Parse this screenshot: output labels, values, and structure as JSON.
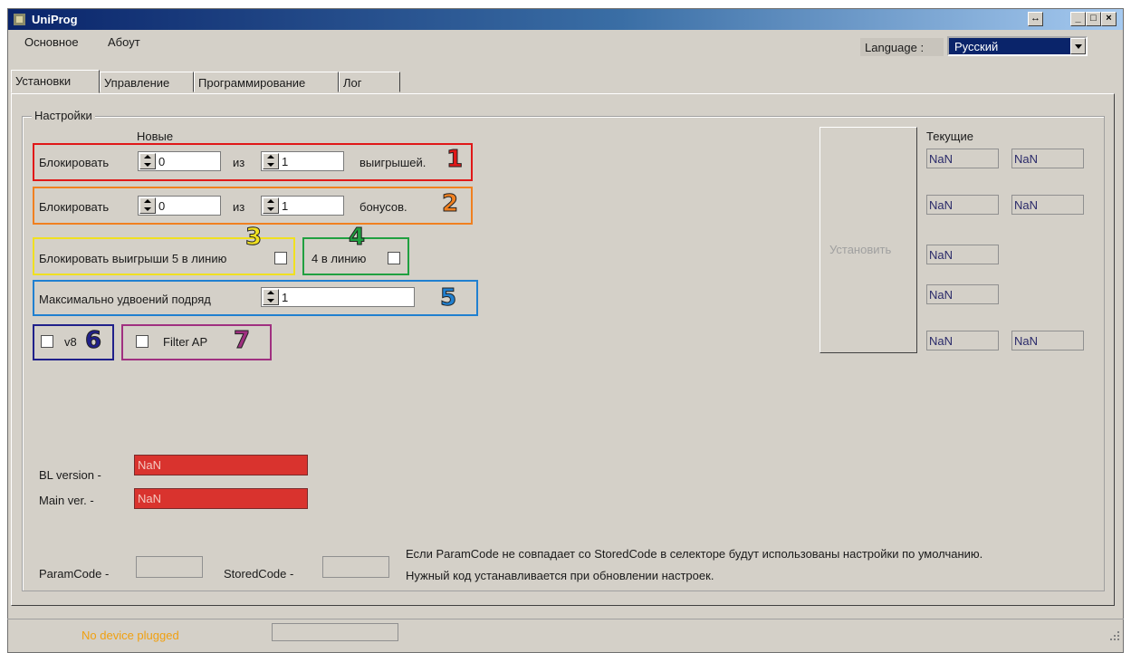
{
  "window": {
    "title": "UniProg"
  },
  "menu": {
    "items": [
      "Основное",
      "Абоут"
    ]
  },
  "language": {
    "label": "Language :",
    "value": "Русский"
  },
  "tabs": [
    "Установки",
    "Управление",
    "Программирование",
    "Лог"
  ],
  "settings": {
    "group_title": "Настройки",
    "new_header": "Новые",
    "current_header": "Текущие",
    "row1": {
      "prefix": "Блокировать",
      "value1": "0",
      "mid": "из",
      "value2": "1",
      "suffix": "выигрышей.",
      "marker": "1"
    },
    "row2": {
      "prefix": "Блокировать",
      "value1": "0",
      "mid": "из",
      "value2": "1",
      "suffix": "бонусов.",
      "marker": "2"
    },
    "row3": {
      "label": "Блокировать выигрыши 5 в линию",
      "marker": "3"
    },
    "row4": {
      "label": "4 в линию",
      "marker": "4"
    },
    "row5": {
      "label": "Максимально удвоений подряд",
      "value": "1",
      "marker": "5"
    },
    "row6": {
      "label": "v8",
      "marker": "6"
    },
    "row7": {
      "label": "Filter AP",
      "marker": "7"
    },
    "set_button": "Установить",
    "current_values": [
      "NaN",
      "NaN",
      "NaN",
      "NaN",
      "NaN",
      "NaN",
      "NaN",
      "NaN"
    ],
    "bl_version": {
      "label": "BL version -",
      "value": "NaN"
    },
    "main_version": {
      "label": "Main ver. -",
      "value": "NaN"
    },
    "param_code_label": "ParamCode -",
    "stored_code_label": "StoredCode -",
    "note_line1": "Если ParamCode не совпадает со StoredCode в селекторе будут использованы настройки по умолчанию.",
    "note_line2": "Нужный код устанавливается при обновлении настроек."
  },
  "marker_colors": {
    "1": "#e01818",
    "2": "#f08020",
    "3": "#f0e020",
    "4": "#20a040",
    "5": "#2080d0",
    "6": "#20208a",
    "7": "#a03080"
  },
  "status": {
    "text": "No device plugged"
  }
}
